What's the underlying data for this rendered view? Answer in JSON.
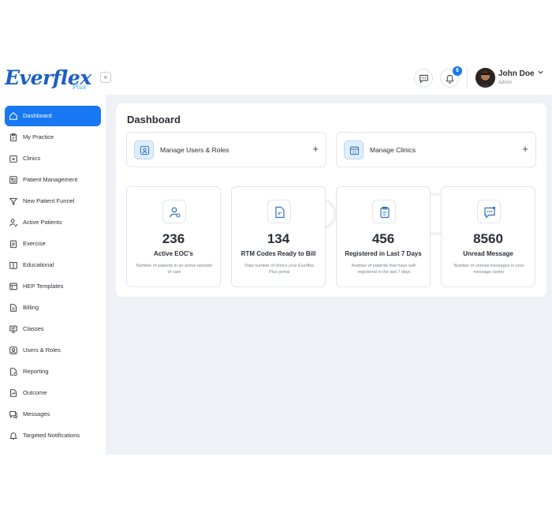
{
  "brand": {
    "name": "Everflex",
    "sub": "Plus"
  },
  "topbar": {
    "collapse_glyph": "«",
    "notification_count": "6",
    "user": {
      "name": "John Doe",
      "role": "Admin"
    }
  },
  "sidebar": {
    "items": [
      {
        "label": "Dashboard",
        "icon": "home-icon",
        "active": true
      },
      {
        "label": "My Practice",
        "icon": "clipboard-icon"
      },
      {
        "label": "Clinics",
        "icon": "clinic-icon"
      },
      {
        "label": "Patient Management",
        "icon": "id-card-icon"
      },
      {
        "label": "New Patient Funnel",
        "icon": "funnel-icon"
      },
      {
        "label": "Active Patients",
        "icon": "user-check-icon"
      },
      {
        "label": "Exercise",
        "icon": "clipboard-list-icon"
      },
      {
        "label": "Educational",
        "icon": "book-icon"
      },
      {
        "label": "HEP Templates",
        "icon": "template-icon"
      },
      {
        "label": "Billing",
        "icon": "document-icon"
      },
      {
        "label": "Classes",
        "icon": "monitor-icon"
      },
      {
        "label": "Users & Roles",
        "icon": "user-circle-icon"
      },
      {
        "label": "Reporting",
        "icon": "report-icon"
      },
      {
        "label": "Outcome",
        "icon": "outcome-icon"
      },
      {
        "label": "Messages",
        "icon": "chat-icon"
      },
      {
        "label": "Targeted Notifications",
        "icon": "bell-icon"
      }
    ]
  },
  "main": {
    "title": "Dashboard",
    "actions": [
      {
        "label": "Manage Users & Roles",
        "icon": "user-square-icon",
        "plus": "+"
      },
      {
        "label": "Manage Clinics",
        "icon": "clinic-icon",
        "plus": "+"
      }
    ],
    "stats": [
      {
        "value": "236",
        "title": "Active EOC's",
        "desc": "Number of patients in an active episode of care",
        "icon": "user-gear-icon"
      },
      {
        "value": "134",
        "title": "RTM Codes Ready to Bill",
        "desc": "Total number of clinics your Everflex Plus portal",
        "icon": "file-code-icon"
      },
      {
        "value": "456",
        "title": "Registered in Last 7 Days",
        "desc": "Number of patients that have self-registered in the last 7 days",
        "icon": "clipboard-icon"
      },
      {
        "value": "8560",
        "title": "Unread Message",
        "desc": "Number of unread messages in your message center",
        "icon": "chat-dots-icon"
      }
    ]
  },
  "colors": {
    "primary": "#1877f2",
    "background": "#eef1f6",
    "text": "#2b2f36"
  }
}
